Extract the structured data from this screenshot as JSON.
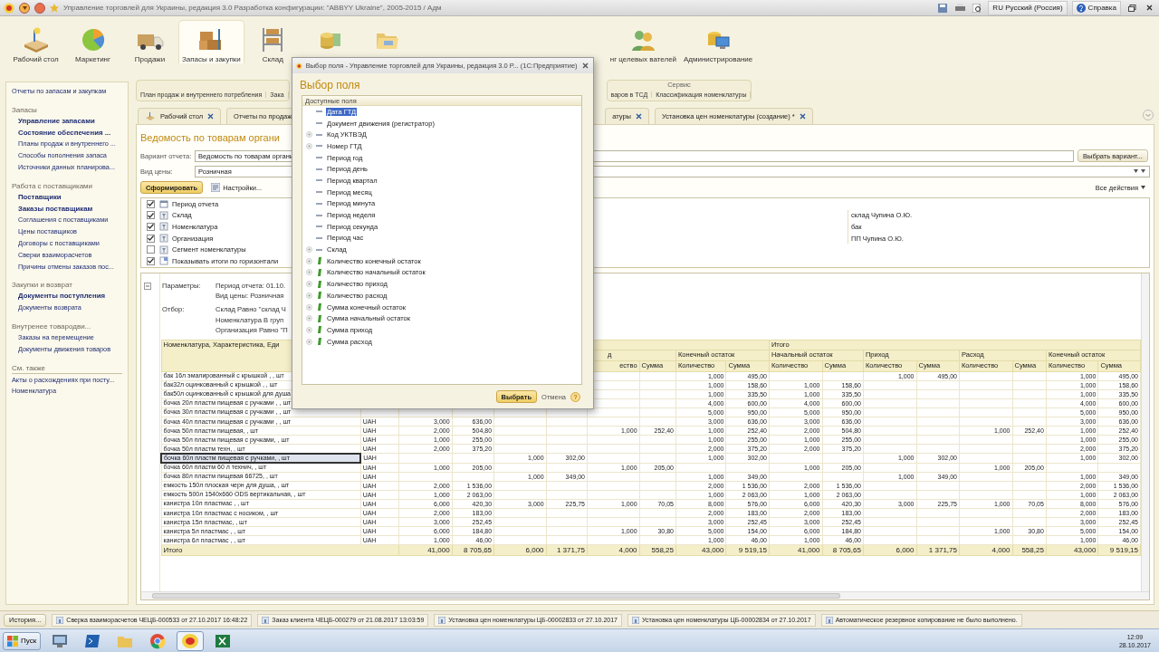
{
  "window": {
    "title": "Управление торговлей для Украины, редакция 3.0 Разработка конфигурации: \"ABBYY Ukraine\", 2005-2015 / Адм",
    "language": "RU Русский (Россия)",
    "help": "Справка"
  },
  "sections": [
    {
      "label": "Рабочий стол",
      "kind": "desk",
      "selected": false
    },
    {
      "label": "Маркетинг",
      "kind": "pie",
      "selected": false
    },
    {
      "label": "Продажи",
      "kind": "truck",
      "selected": false
    },
    {
      "label": "Запасы и закупки",
      "kind": "boxes",
      "selected": true
    },
    {
      "label": "Склад",
      "kind": "shelves",
      "selected": false
    },
    {
      "kind": "coins",
      "selected": false
    },
    {
      "kind": "folder",
      "selected": false
    },
    {
      "label": "нг целевых вателей",
      "kind": "people",
      "selected": false
    },
    {
      "label": "Администрирование",
      "kind": "computer",
      "selected": false
    }
  ],
  "sidebar": {
    "top_link": "Отчеты по запасам и закупкам",
    "groups": [
      {
        "title": "Запасы",
        "kind": "section",
        "items": [
          {
            "label": "Управление запасами",
            "important": true
          },
          {
            "label": "Состояние обеспечения ...",
            "important": true
          },
          {
            "label": "Планы продаж и внутреннего ...",
            "important": false
          },
          {
            "label": "Способы пополнения запаса",
            "important": false
          },
          {
            "label": "Источники данных планирова...",
            "important": false
          }
        ]
      },
      {
        "title": "Работа с поставщиками",
        "kind": "section",
        "items": [
          {
            "label": "Поставщики",
            "important": true
          },
          {
            "label": "Заказы поставщикам",
            "important": true
          },
          {
            "label": "Соглашения с поставщиками",
            "important": false
          },
          {
            "label": "Цены поставщиков",
            "important": false
          },
          {
            "label": "Договоры с поставщиками",
            "important": false
          },
          {
            "label": "Сверки взаиморасчетов",
            "important": false
          },
          {
            "label": "Причины отмены заказов пос...",
            "important": false
          }
        ]
      },
      {
        "title": "Закупки и возврат",
        "kind": "section",
        "items": [
          {
            "label": "Документы поступления",
            "important": true
          },
          {
            "label": "Документы возврата",
            "important": false
          }
        ]
      },
      {
        "title": "Внутренее товародви...",
        "kind": "section",
        "items": [
          {
            "label": "Заказы на перемещение",
            "important": false
          },
          {
            "label": "Документы движения товаров",
            "important": false
          }
        ]
      },
      {
        "title": "См. также",
        "kind": "see_also",
        "items": [
          {
            "label": "Акты о расхождениях при посту...",
            "important": false
          },
          {
            "label": "Номенклатура",
            "important": false
          }
        ]
      }
    ]
  },
  "commands": {
    "left": [
      "План продаж и внутреннего потребления",
      "Зака"
    ],
    "service": {
      "title": "Сервис",
      "items": [
        "варов в ТСД",
        "Классификация номенклатуры"
      ]
    }
  },
  "tabs": [
    {
      "label": "Рабочий стол",
      "kind": "home",
      "selected": false
    },
    {
      "label": "Отчеты по продаж",
      "kind": "page",
      "selected": false
    },
    {
      "label": "атуры",
      "kind": "page",
      "selected": false
    },
    {
      "label": "Установка цен номенклатуры (создание) *",
      "kind": "page",
      "selected": false
    }
  ],
  "report": {
    "title": "Ведомость по товарам органи",
    "variant_label": "Вариант отчета:",
    "variant_value": "Ведомость по товарам органи",
    "choose_variant": "Выбрать вариант...",
    "price_label": "Вид цены:",
    "price_value": "Розничная",
    "generate": "Сформировать",
    "settings_button": "Настройки...",
    "all_actions": "Все действия",
    "settings": [
      {
        "checked": true,
        "kind": "period",
        "label": "Период отчета"
      },
      {
        "checked": true,
        "kind": "filter",
        "label": "Склад",
        "value": "склад Чупина О.Ю."
      },
      {
        "checked": true,
        "kind": "filter",
        "label": "Номенклатура",
        "value": "бак"
      },
      {
        "checked": true,
        "kind": "filter",
        "label": "Организация",
        "value": "ПП Чупина О.Ю."
      },
      {
        "checked": false,
        "kind": "filter",
        "label": "Сегмент номенклатуры"
      },
      {
        "checked": true,
        "kind": "option",
        "label": "Показывать итоги по горизонтали"
      }
    ],
    "params": [
      {
        "label": "Параметры:",
        "lines": [
          "Период отчета: 01.10.",
          "Вид цены: Розничная"
        ]
      },
      {
        "label": "Отбор:",
        "lines": [
          "Склад Равно \"склад Ч",
          "Номенклатура В груп",
          "Организация Равно \"П"
        ]
      }
    ],
    "table": {
      "name_header": "Номенклатура, Характеристика, Еди",
      "pre_groups": [
        {
          "label": "д",
          "columns": [
            "ество",
            "Сумма"
          ]
        },
        {
          "label": "Конечный остаток",
          "columns": [
            "Количество",
            "Сумма"
          ]
        }
      ],
      "total_block": {
        "label": "Итого",
        "groups": [
          {
            "label": "Начальный остаток",
            "columns": [
              "Количество",
              "Сумма"
            ]
          },
          {
            "label": "Приход",
            "columns": [
              "Количество",
              "Сумма"
            ]
          },
          {
            "label": "Расход",
            "columns": [
              "Количество",
              "Сумма"
            ]
          },
          {
            "label": "Конечный остаток",
            "columns": [
              "Количество",
              "Сумма"
            ]
          }
        ]
      },
      "rows": [
        {
          "name": "бак 16л эмалированный с крышкой , , шт",
          "unit": null,
          "selected": false,
          "cells": [
            null,
            null,
            null,
            null,
            null,
            null,
            "1,000",
            "495,00",
            null,
            null,
            "1,000",
            "495,00",
            null,
            null,
            "1,000",
            "495,00"
          ]
        },
        {
          "name": "бак32л оцинкованный с крышкой , , шт",
          "unit": null,
          "selected": false,
          "cells": [
            null,
            null,
            null,
            null,
            null,
            null,
            "1,000",
            "158,60",
            "1,000",
            "158,60",
            null,
            null,
            null,
            null,
            "1,000",
            "158,60"
          ]
        },
        {
          "name": "бак50л оцинкованный с крышкой для душа",
          "unit": null,
          "selected": false,
          "cells": [
            null,
            null,
            null,
            null,
            null,
            null,
            "1,000",
            "335,50",
            "1,000",
            "335,50",
            null,
            null,
            null,
            null,
            "1,000",
            "335,50"
          ]
        },
        {
          "name": "бочка 20л пластм пищевая с ручками , , шт",
          "unit": null,
          "selected": false,
          "cells": [
            null,
            null,
            null,
            null,
            null,
            null,
            "4,000",
            "600,00",
            "4,000",
            "600,00",
            null,
            null,
            null,
            null,
            "4,000",
            "600,00"
          ]
        },
        {
          "name": "бочка 30л пластм пищевая с ручками , , шт",
          "unit": null,
          "selected": false,
          "cells": [
            null,
            null,
            null,
            null,
            null,
            null,
            "5,000",
            "950,00",
            "5,000",
            "950,00",
            null,
            null,
            null,
            null,
            "5,000",
            "950,00"
          ]
        },
        {
          "name": "бочка 40л пластм пищевая с  ручками , , шт",
          "unit": "UAH",
          "selected": false,
          "cells": [
            "3,000",
            "636,00",
            null,
            null,
            null,
            null,
            "3,000",
            "636,00",
            "3,000",
            "636,00",
            null,
            null,
            null,
            null,
            "3,000",
            "636,00"
          ]
        },
        {
          "name": "бочка 50л пластм пищевая, , шт",
          "unit": "UAH",
          "selected": false,
          "cells": [
            "2,000",
            "504,80",
            null,
            null,
            "1,000",
            "252,40",
            "1,000",
            "252,40",
            "2,000",
            "504,80",
            null,
            null,
            "1,000",
            "252,40",
            "1,000",
            "252,40"
          ]
        },
        {
          "name": "бочка 50л пластм пищевая с ручками, , шт",
          "unit": "UAH",
          "selected": false,
          "cells": [
            "1,000",
            "255,00",
            null,
            null,
            null,
            null,
            "1,000",
            "255,00",
            "1,000",
            "255,00",
            null,
            null,
            null,
            null,
            "1,000",
            "255,00"
          ]
        },
        {
          "name": "бочка 50л пластм техн, , шт",
          "unit": "UAH",
          "selected": false,
          "cells": [
            "2,000",
            "375,20",
            null,
            null,
            null,
            null,
            "2,000",
            "375,20",
            "2,000",
            "375,20",
            null,
            null,
            null,
            null,
            "2,000",
            "375,20"
          ]
        },
        {
          "name": "бочка 60л пластм  пищевая с ручками, , шт",
          "unit": "UAH",
          "selected": true,
          "cells": [
            null,
            null,
            "1,000",
            "302,00",
            null,
            null,
            "1,000",
            "302,00",
            null,
            null,
            "1,000",
            "302,00",
            null,
            null,
            "1,000",
            "302,00"
          ]
        },
        {
          "name": "бочка 60л пластм 60 л технич, , шт",
          "unit": "UAH",
          "selected": false,
          "cells": [
            "1,000",
            "205,00",
            null,
            null,
            "1,000",
            "205,00",
            null,
            null,
            "1,000",
            "205,00",
            null,
            null,
            "1,000",
            "205,00",
            null,
            null
          ]
        },
        {
          "name": "бочка 80л пластм пищевая 66725, , шт",
          "unit": "UAH",
          "selected": false,
          "cells": [
            null,
            null,
            "1,000",
            "349,00",
            null,
            null,
            "1,000",
            "349,00",
            null,
            null,
            "1,000",
            "349,00",
            null,
            null,
            "1,000",
            "349,00"
          ]
        },
        {
          "name": "емкость 150л плоская черн для душа, , шт",
          "unit": "UAH",
          "selected": false,
          "cells": [
            "2,000",
            "1 536,00",
            null,
            null,
            null,
            null,
            "2,000",
            "1 536,00",
            "2,000",
            "1 536,00",
            null,
            null,
            null,
            null,
            "2,000",
            "1 536,00"
          ]
        },
        {
          "name": "емкость 500л 1540х660 ODS вертикальная, , шт",
          "unit": "UAH",
          "selected": false,
          "cells": [
            "1,000",
            "2 063,00",
            null,
            null,
            null,
            null,
            "1,000",
            "2 063,00",
            "1,000",
            "2 063,00",
            null,
            null,
            null,
            null,
            "1,000",
            "2 063,00"
          ]
        },
        {
          "name": "канистра 10л пластмас , , шт",
          "unit": "UAH",
          "selected": false,
          "cells": [
            "6,000",
            "420,30",
            "3,000",
            "225,75",
            "1,000",
            "70,05",
            "8,000",
            "576,00",
            "6,000",
            "420,30",
            "3,000",
            "225,75",
            "1,000",
            "70,05",
            "8,000",
            "576,00"
          ]
        },
        {
          "name": "канистра 10л пластмас с носиком, , шт",
          "unit": "UAH",
          "selected": false,
          "cells": [
            "2,000",
            "183,00",
            null,
            null,
            null,
            null,
            "2,000",
            "183,00",
            "2,000",
            "183,00",
            null,
            null,
            null,
            null,
            "2,000",
            "183,00"
          ]
        },
        {
          "name": "канистра 15л пластмас, , шт",
          "unit": "UAH",
          "selected": false,
          "cells": [
            "3,000",
            "252,45",
            null,
            null,
            null,
            null,
            "3,000",
            "252,45",
            "3,000",
            "252,45",
            null,
            null,
            null,
            null,
            "3,000",
            "252,45"
          ]
        },
        {
          "name": "канистра 5л пластмас , , шт",
          "unit": "UAH",
          "selected": false,
          "cells": [
            "6,000",
            "184,80",
            null,
            null,
            "1,000",
            "30,80",
            "5,000",
            "154,00",
            "6,000",
            "184,80",
            null,
            null,
            "1,000",
            "30,80",
            "5,000",
            "154,00"
          ]
        },
        {
          "name": "канистра 6л пластмас , , шт",
          "unit": "UAH",
          "selected": false,
          "cells": [
            "1,000",
            "46,00",
            null,
            null,
            null,
            null,
            "1,000",
            "46,00",
            "1,000",
            "46,00",
            null,
            null,
            null,
            null,
            "1,000",
            "46,00"
          ]
        }
      ],
      "total_row": {
        "label": "Итого",
        "cells": [
          "41,000",
          "8 705,65",
          "6,000",
          "1 371,75",
          "4,000",
          "558,25",
          "43,000",
          "9 519,15",
          "41,000",
          "8 705,65",
          "6,000",
          "1 371,75",
          "4,000",
          "558,25",
          "43,000",
          "9 519,15"
        ]
      }
    }
  },
  "dialog": {
    "title": "Выбор поля - Управление торговлей для Украины, редакция 3.0 Р... (1С:Предприятие)",
    "heading": "Выбор поля",
    "list_header": "Доступные поля",
    "items": [
      {
        "label": "Дата ГТД",
        "kind": "field",
        "expandable": false,
        "selected": true
      },
      {
        "label": "Документ движения (регистратор)",
        "kind": "field",
        "expandable": false,
        "selected": false
      },
      {
        "label": "Код УКТВЭД",
        "kind": "field",
        "expandable": true,
        "selected": false
      },
      {
        "label": "Номер ГТД",
        "kind": "field",
        "expandable": true,
        "selected": false
      },
      {
        "label": "Период год",
        "kind": "field",
        "expandable": false,
        "selected": false
      },
      {
        "label": "Период день",
        "kind": "field",
        "expandable": false,
        "selected": false
      },
      {
        "label": "Период квартал",
        "kind": "field",
        "expandable": false,
        "selected": false
      },
      {
        "label": "Период месяц",
        "kind": "field",
        "expandable": false,
        "selected": false
      },
      {
        "label": "Период минута",
        "kind": "field",
        "expandable": false,
        "selected": false
      },
      {
        "label": "Период неделя",
        "kind": "field",
        "expandable": false,
        "selected": false
      },
      {
        "label": "Период секунда",
        "kind": "field",
        "expandable": false,
        "selected": false
      },
      {
        "label": "Период час",
        "kind": "field",
        "expandable": false,
        "selected": false
      },
      {
        "label": "Склад",
        "kind": "field",
        "expandable": true,
        "selected": false
      },
      {
        "label": "Количество конечный остаток",
        "kind": "resource",
        "expandable": true,
        "selected": false
      },
      {
        "label": "Количество начальный остаток",
        "kind": "resource",
        "expandable": true,
        "selected": false
      },
      {
        "label": "Количество приход",
        "kind": "resource",
        "expandable": true,
        "selected": false
      },
      {
        "label": "Количество расход",
        "kind": "resource",
        "expandable": true,
        "selected": false
      },
      {
        "label": "Сумма конечный остаток",
        "kind": "resource",
        "expandable": true,
        "selected": false
      },
      {
        "label": "Сумма начальный остаток",
        "kind": "resource",
        "expandable": true,
        "selected": false
      },
      {
        "label": "Сумма приход",
        "kind": "resource",
        "expandable": true,
        "selected": false
      },
      {
        "label": "Сумма расход",
        "kind": "resource",
        "expandable": true,
        "selected": false
      }
    ],
    "ok": "Выбрать",
    "cancel": "Отмена",
    "help": "?"
  },
  "status": {
    "history": "История...",
    "messages": [
      "Сверка взаиморасчетов ЧЕЦБ-000533 от 27.10.2017 16:48:22",
      "Заказ клиента ЧЕЦБ-000279 от 21.08.2017 13:03:59",
      "Установка цен номенклатуры ЦБ-00002833 от 27.10.2017",
      "Установка цен номенклатуры ЦБ-00002834 от 27.10.2017",
      "Автоматическое резервное копирование не было выполнено."
    ]
  },
  "taskbar": {
    "start": "Пуск",
    "apps": [
      {
        "kind": "explorer",
        "selected": false
      },
      {
        "kind": "shell",
        "selected": false
      },
      {
        "kind": "folder",
        "selected": false
      },
      {
        "kind": "browser",
        "selected": false
      },
      {
        "kind": "onec",
        "selected": true
      },
      {
        "kind": "sheet",
        "selected": false
      }
    ],
    "time": "12:09",
    "date": "28.10.2017"
  }
}
